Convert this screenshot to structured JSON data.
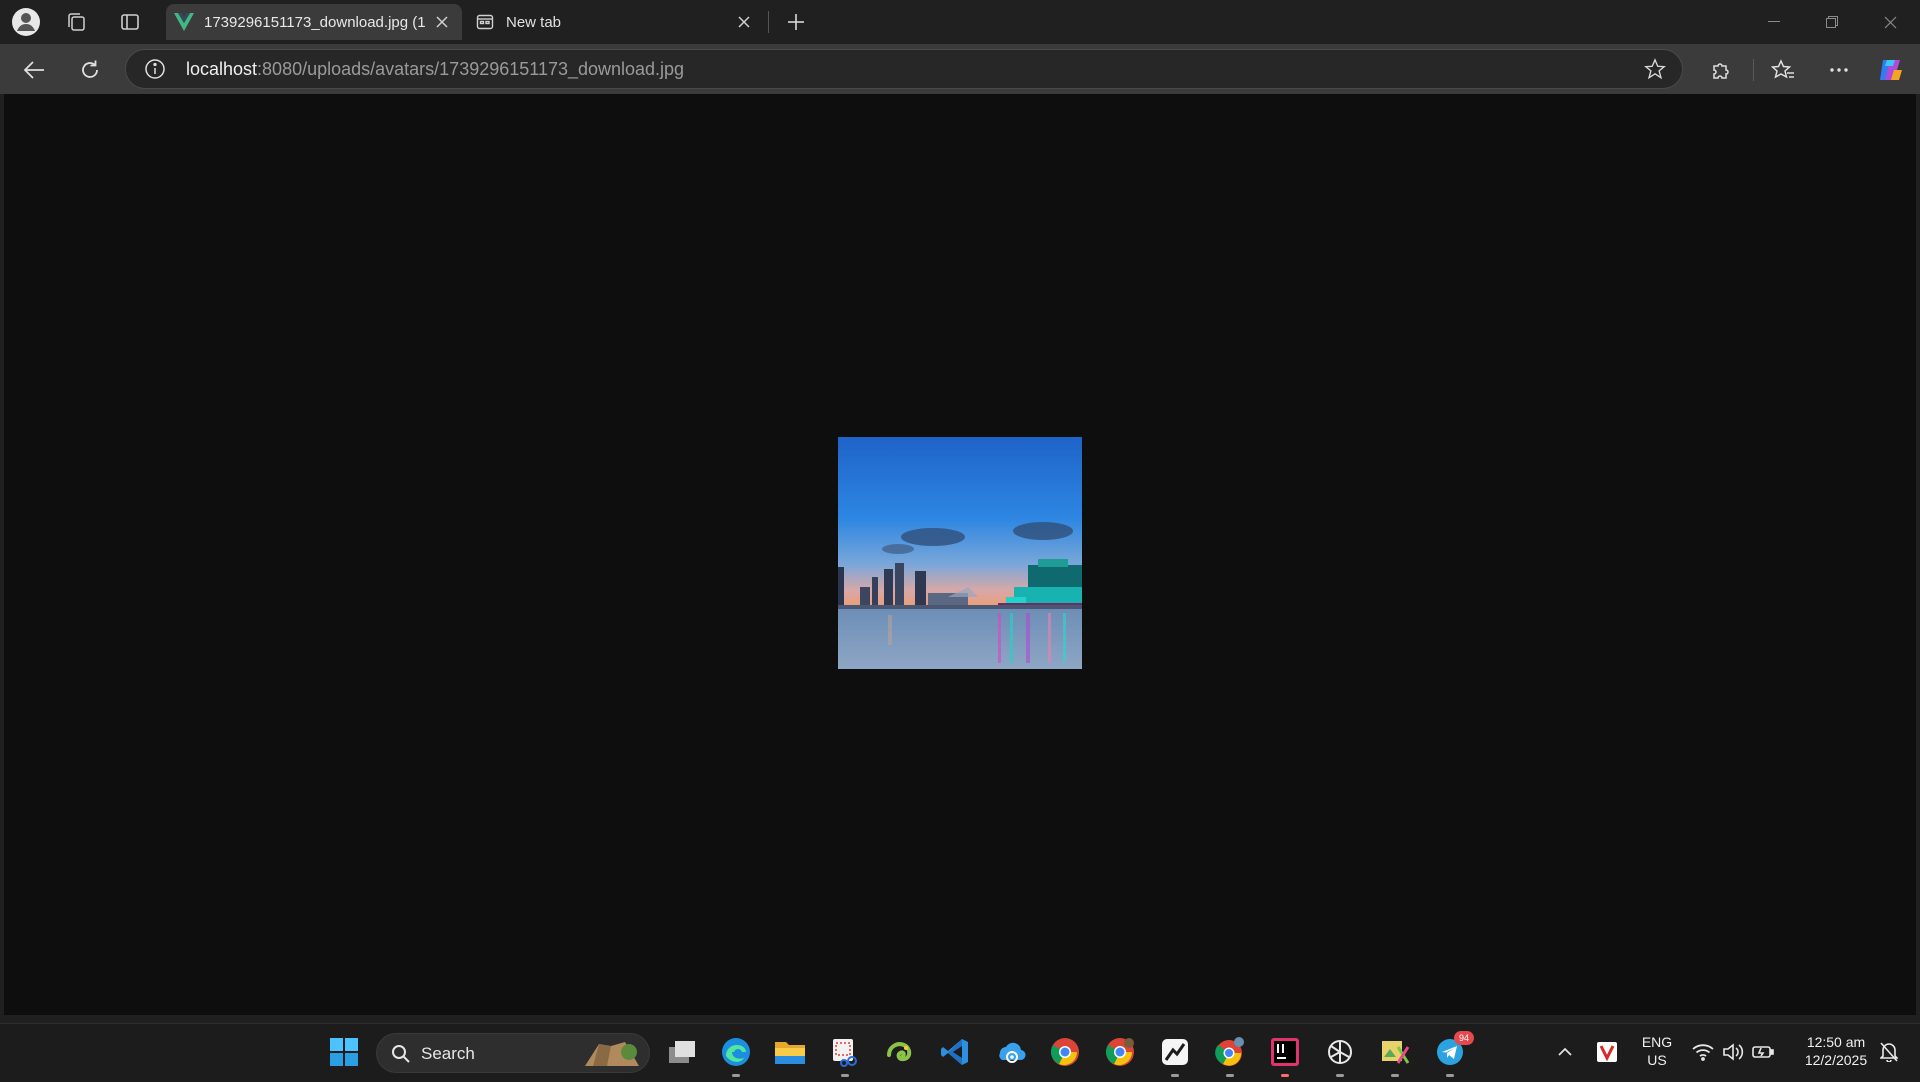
{
  "browser": {
    "tabs": [
      {
        "title": "1739296151173_download.jpg (1",
        "active": true
      },
      {
        "title": "New tab",
        "active": false
      }
    ],
    "url_host": "localhost",
    "url_rest": ":8080/uploads/avatars/1739296151173_download.jpg",
    "colors": {
      "frame": "#202020",
      "toolbar": "#3b3b3b",
      "viewport": "#0e0e0e",
      "vue_green": "#41b883"
    }
  },
  "taskbar": {
    "search_label": "Search",
    "telegram_badge": "94",
    "language": {
      "line1": "ENG",
      "line2": "US"
    },
    "clock": {
      "time": "12:50 am",
      "date": "12/2/2025"
    }
  },
  "icons": [
    "profile-icon",
    "workspaces-icon",
    "vertical-tabs-icon",
    "vue-favicon",
    "close-icon",
    "new-tab-page-icon",
    "new-tab-icon",
    "minimize-icon",
    "restore-icon",
    "back-icon",
    "refresh-icon",
    "info-icon",
    "favorite-star-icon",
    "extensions-icon",
    "favorites-icon",
    "more-icon",
    "copilot-icon",
    "windows-start-icon",
    "search-icon",
    "task-view-icon",
    "edge-icon",
    "file-explorer-icon",
    "snipping-tool-icon",
    "chameleon-icon",
    "vscode-icon",
    "azure-data-studio-icon",
    "chrome-icon",
    "chrome-dev-icon",
    "trading-app-icon",
    "chrome-profile-icon",
    "intellij-icon",
    "chatgpt-icon",
    "image-editor-icon",
    "telegram-icon",
    "chevron-up-icon",
    "vivaldi-icon",
    "wifi-icon",
    "volume-icon",
    "battery-icon",
    "notifications-icon"
  ]
}
